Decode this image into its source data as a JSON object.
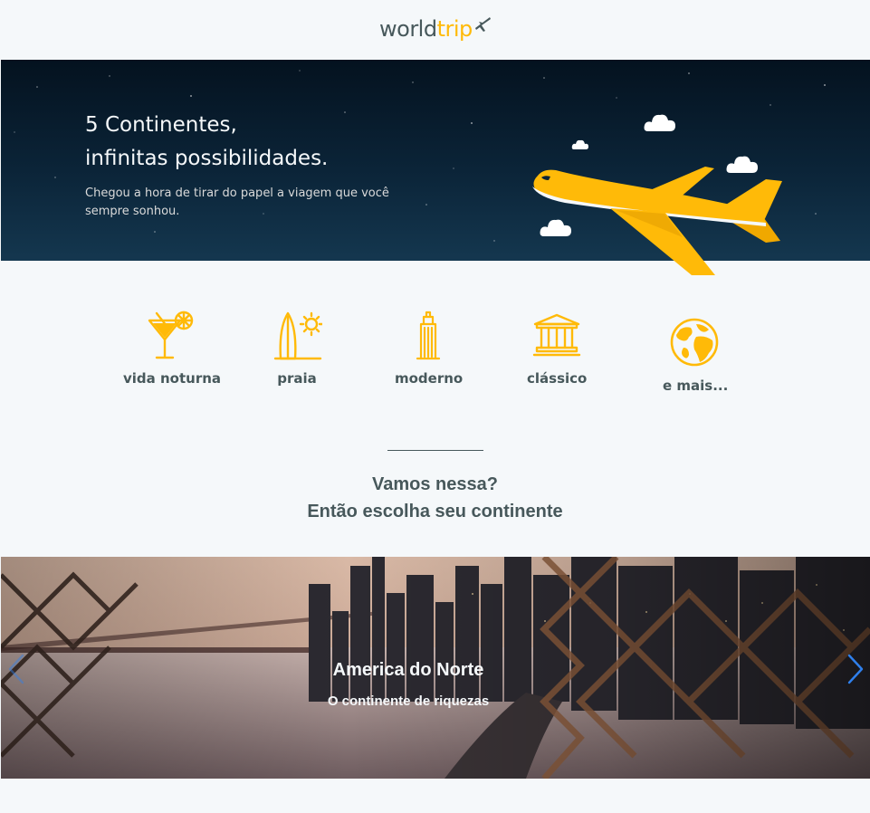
{
  "header": {
    "logo_part1": "world",
    "logo_part2": "trip"
  },
  "banner": {
    "title_line1": "5 Continentes,",
    "title_line2": "infinitas possibilidades.",
    "subtitle": "Chegou a hora de tirar do papel a viagem que você sempre sonhou."
  },
  "travel_types": [
    {
      "label": "vida noturna",
      "icon": "cocktail-icon"
    },
    {
      "label": "praia",
      "icon": "surf-icon"
    },
    {
      "label": "moderno",
      "icon": "building-icon"
    },
    {
      "label": "clássico",
      "icon": "museum-icon"
    },
    {
      "label": "e mais...",
      "icon": "globe-icon"
    }
  ],
  "cta": {
    "line1": "Vamos nessa?",
    "line2": "Então escolha seu continente"
  },
  "slider": {
    "title": "America do Norte",
    "subtitle": "O continente de riquezas",
    "prev_icon": "chevron-left-icon",
    "next_icon": "chevron-right-icon"
  },
  "colors": {
    "background": "#f5f8fa",
    "accent": "#ffba08",
    "text": "#47585b",
    "arrow": "#2f80ed"
  }
}
